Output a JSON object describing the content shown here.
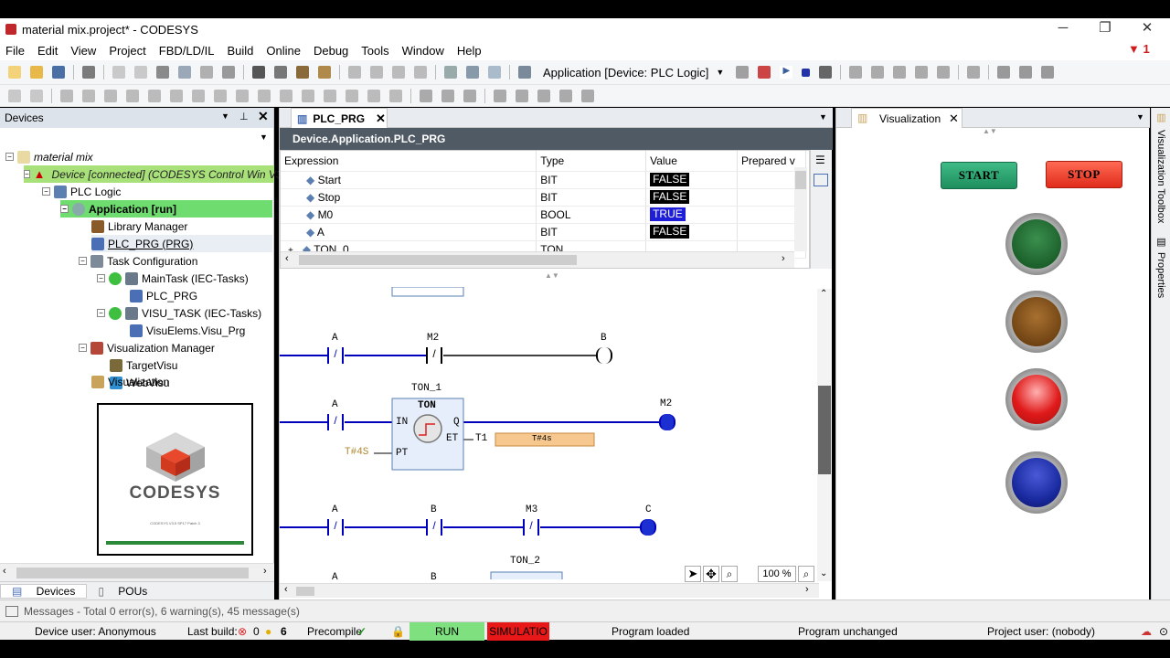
{
  "window": {
    "title": "material mix.project* - CODESYS"
  },
  "menu": [
    "File",
    "Edit",
    "View",
    "Project",
    "FBD/LD/IL",
    "Build",
    "Online",
    "Debug",
    "Tools",
    "Window",
    "Help"
  ],
  "toolbar": {
    "app_select": "Application [Device: PLC Logic]",
    "alert_count": "1"
  },
  "devices_panel": {
    "title": "Devices",
    "tree": [
      {
        "label": "material mix",
        "level": 0
      },
      {
        "label": "Device [connected] (CODESYS Control Win V3",
        "level": 1
      },
      {
        "label": "PLC Logic",
        "level": 2
      },
      {
        "label": "Application [run]",
        "level": 3
      },
      {
        "label": "Library Manager",
        "level": 4
      },
      {
        "label": "PLC_PRG (PRG)",
        "level": 4
      },
      {
        "label": "Task Configuration",
        "level": 4
      },
      {
        "label": "MainTask (IEC-Tasks)",
        "level": 5
      },
      {
        "label": "PLC_PRG",
        "level": 6
      },
      {
        "label": "VISU_TASK (IEC-Tasks)",
        "level": 5
      },
      {
        "label": "VisuElems.Visu_Prg",
        "level": 6
      },
      {
        "label": "Visualization Manager",
        "level": 4
      },
      {
        "label": "TargetVisu",
        "level": 5
      },
      {
        "label": "WebVisu",
        "level": 5
      },
      {
        "label": "Visualization",
        "level": 4
      }
    ],
    "logo_text": "CODESYS",
    "logo_version": "CODESYS V3.5 SP17 Patch 3",
    "bottom_tabs": [
      "Devices",
      "POUs"
    ]
  },
  "editor": {
    "tab": "PLC_PRG",
    "path": "Device.Application.PLC_PRG",
    "watch_headers": [
      "Expression",
      "Type",
      "Value",
      "Prepared v"
    ],
    "watch_rows": [
      {
        "expr": "Start",
        "type": "BIT",
        "value": "FALSE"
      },
      {
        "expr": "Stop",
        "type": "BIT",
        "value": "FALSE"
      },
      {
        "expr": "M0",
        "type": "BOOL",
        "value": "TRUE"
      },
      {
        "expr": "A",
        "type": "BIT",
        "value": "FALSE"
      },
      {
        "expr": "TON_0",
        "type": "TON",
        "value": ""
      }
    ],
    "ladder": {
      "rung1": {
        "c1": "A",
        "c2": "M2",
        "coil": "B"
      },
      "rung2": {
        "block_name": "TON_1",
        "block_type": "TON",
        "c1": "A",
        "coil": "M2",
        "in": "IN",
        "q": "Q",
        "et": "ET",
        "pt": "PT",
        "pt_val": "T#4S",
        "et_var": "T1",
        "et_val": "T#4s"
      },
      "rung3": {
        "c1": "A",
        "c2": "B",
        "c3": "M3",
        "coil": "C"
      },
      "rung4": {
        "block_name": "TON_2",
        "block_type": "TON",
        "c1": "A",
        "c2": "B"
      }
    },
    "zoom": "100 %"
  },
  "visualization": {
    "tab": "Visualization",
    "start_label": "START",
    "stop_label": "STOP",
    "lamp_colors": [
      "#1b6b2a",
      "#7a4a12",
      "#e01a1a",
      "#1a2aa0"
    ]
  },
  "right_side_tabs": [
    "Visualization Toolbox",
    "Properties"
  ],
  "messages": "Messages - Total 0 error(s), 6 warning(s), 45 message(s)",
  "status": {
    "device_user": "Device user: Anonymous",
    "last_build": "Last build:",
    "errors": "0",
    "warnings": "6",
    "precompile": "Precompile",
    "run": "RUN",
    "simulation": "SIMULATIO",
    "program_loaded": "Program loaded",
    "program_unchanged": "Program unchanged",
    "project_user": "Project user: (nobody)"
  }
}
